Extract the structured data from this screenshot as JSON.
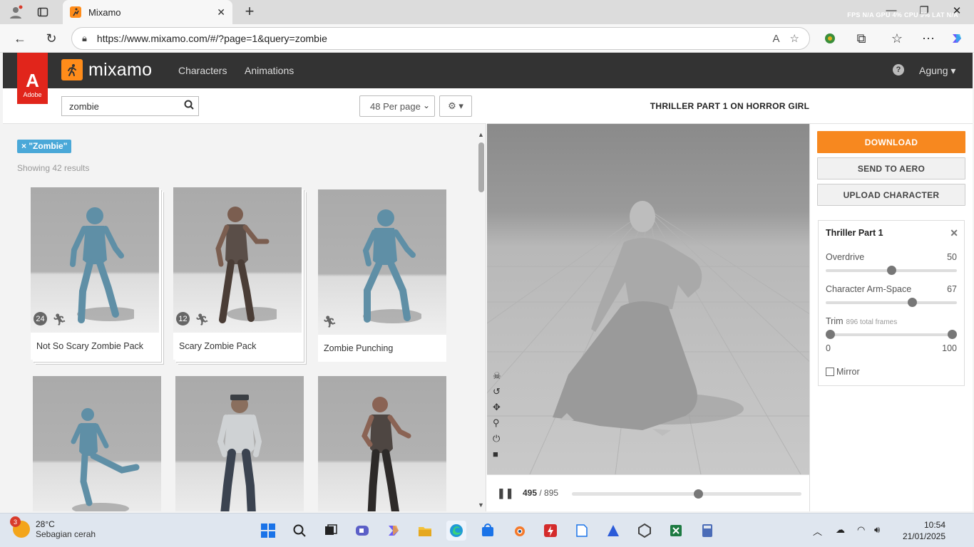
{
  "browser": {
    "tab_title": "Mixamo",
    "url": "https://www.mixamo.com/#/?page=1&query=zombie",
    "perf_overlay": "FPS  N/A GPU  4% CPU  9% LAT  N/A"
  },
  "app": {
    "adobe_label": "Adobe",
    "brand_name": "mixamo",
    "nav": {
      "characters": "Characters",
      "animations": "Animations"
    },
    "help": "?",
    "user_name": "Agung ▾"
  },
  "search": {
    "query": "zombie",
    "per_page": "48 Per page",
    "tag": "× \"Zombie\"",
    "results_text": "Showing 42 results"
  },
  "results": [
    {
      "label": "Not So Scary Zombie Pack",
      "count": "24",
      "color": "#5f8fa6"
    },
    {
      "label": "Scary Zombie Pack",
      "count": "12",
      "color": "#6b5a50"
    },
    {
      "label": "Zombie Punching",
      "count": "",
      "color": "#5f8fa6"
    },
    {
      "label": "",
      "count": "",
      "color": "#5f8fa6"
    },
    {
      "label": "",
      "count": "",
      "color": "#5d5a52"
    },
    {
      "label": "",
      "count": "",
      "color": "#4e4642"
    }
  ],
  "viewer": {
    "title": "THRILLER PART 1 ON HORROR GIRL",
    "current_frame": "495",
    "total_frames": "/ 895",
    "playback_progress": 0.553
  },
  "actions": {
    "download": "DOWNLOAD",
    "send_to_aero": "SEND TO AERO",
    "upload_character": "UPLOAD CHARACTER"
  },
  "settings": {
    "title": "Thriller Part 1",
    "overdrive_label": "Overdrive",
    "overdrive_value": "50",
    "armspace_label": "Character Arm-Space",
    "armspace_value": "67",
    "trim_label": "Trim",
    "trim_sub": "896 total frames",
    "trim_min": "0",
    "trim_max": "100",
    "mirror_label": "Mirror"
  },
  "taskbar": {
    "badge": "3",
    "temp": "28°C",
    "weather": "Sebagian cerah",
    "time": "10:54",
    "date": "21/01/2025"
  }
}
